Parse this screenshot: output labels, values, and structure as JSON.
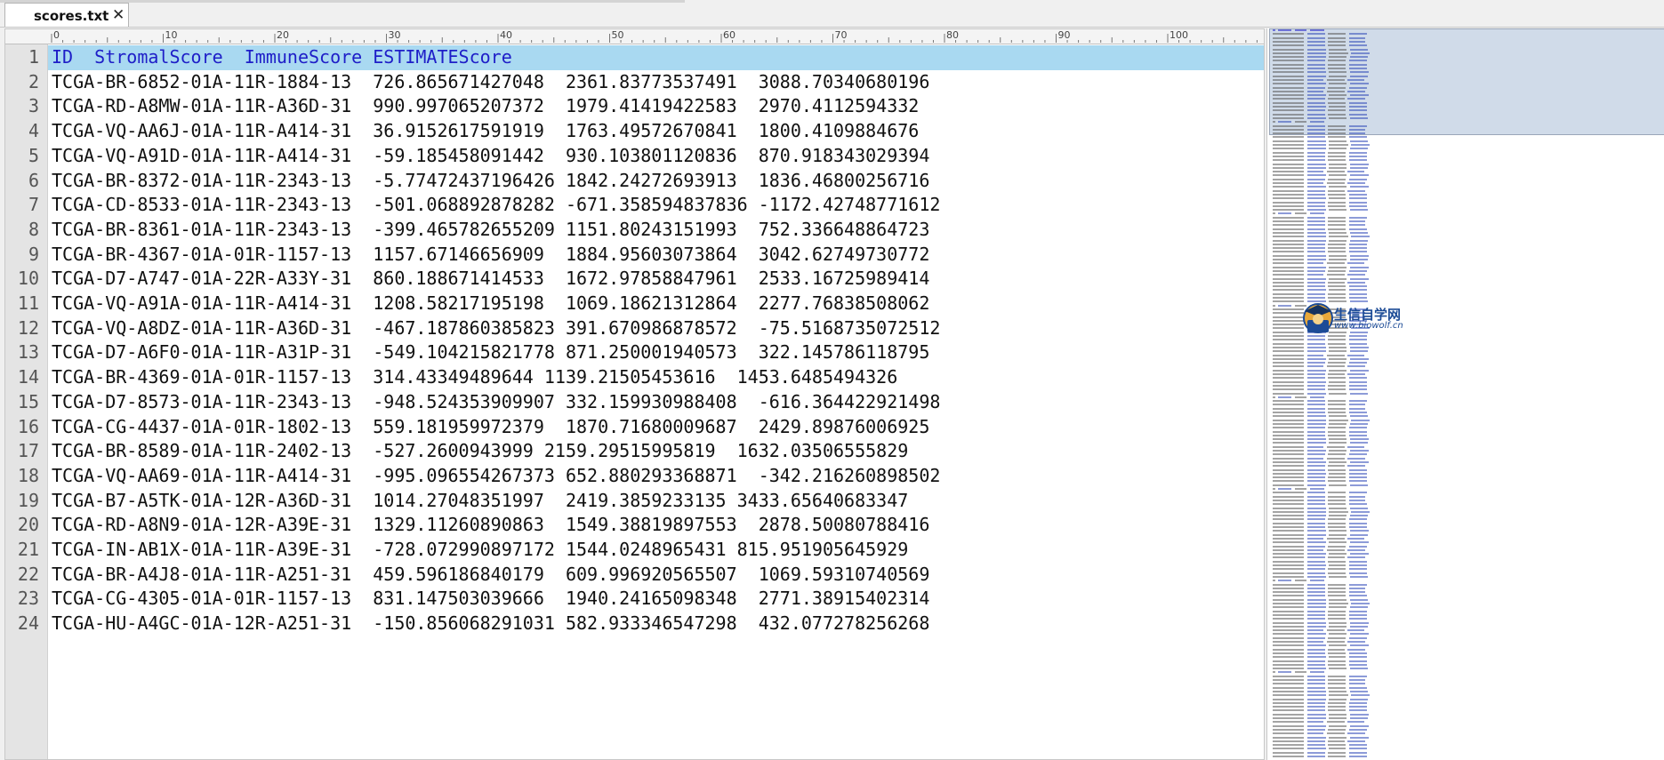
{
  "tab": {
    "title": "scores.txt",
    "close_glyph": "✕"
  },
  "ruler": {
    "labels": [
      "0",
      "10",
      "20",
      "30",
      "40",
      "50",
      "60",
      "70",
      "80",
      "90",
      "100"
    ]
  },
  "editor": {
    "current_line": 1,
    "lines": [
      {
        "num": "1",
        "text": "ID  StromalScore  ImmuneScore ESTIMATEScore"
      },
      {
        "num": "2",
        "text": "TCGA-BR-6852-01A-11R-1884-13  726.865671427048  2361.83773537491  3088.70340680196"
      },
      {
        "num": "3",
        "text": "TCGA-RD-A8MW-01A-11R-A36D-31  990.997065207372  1979.41419422583  2970.4112594332"
      },
      {
        "num": "4",
        "text": "TCGA-VQ-AA6J-01A-11R-A414-31  36.9152617591919  1763.49572670841  1800.4109884676"
      },
      {
        "num": "5",
        "text": "TCGA-VQ-A91D-01A-11R-A414-31  -59.185458091442  930.103801120836  870.918343029394"
      },
      {
        "num": "6",
        "text": "TCGA-BR-8372-01A-11R-2343-13  -5.77472437196426 1842.24272693913  1836.46800256716"
      },
      {
        "num": "7",
        "text": "TCGA-CD-8533-01A-11R-2343-13  -501.068892878282 -671.358594837836 -1172.42748771612"
      },
      {
        "num": "8",
        "text": "TCGA-BR-8361-01A-11R-2343-13  -399.465782655209 1151.80243151993  752.336648864723"
      },
      {
        "num": "9",
        "text": "TCGA-BR-4367-01A-01R-1157-13  1157.67146656909  1884.95603073864  3042.62749730772"
      },
      {
        "num": "10",
        "text": "TCGA-D7-A747-01A-22R-A33Y-31  860.188671414533  1672.97858847961  2533.16725989414"
      },
      {
        "num": "11",
        "text": "TCGA-VQ-A91A-01A-11R-A414-31  1208.58217195198  1069.18621312864  2277.76838508062"
      },
      {
        "num": "12",
        "text": "TCGA-VQ-A8DZ-01A-11R-A36D-31  -467.187860385823 391.670986878572  -75.5168735072512"
      },
      {
        "num": "13",
        "text": "TCGA-D7-A6F0-01A-11R-A31P-31  -549.104215821778 871.250001940573  322.145786118795"
      },
      {
        "num": "14",
        "text": "TCGA-BR-4369-01A-01R-1157-13  314.43349489644 1139.21505453616  1453.6485494326"
      },
      {
        "num": "15",
        "text": "TCGA-D7-8573-01A-11R-2343-13  -948.524353909907 332.159930988408  -616.364422921498"
      },
      {
        "num": "16",
        "text": "TCGA-CG-4437-01A-01R-1802-13  559.181959972379  1870.71680009687  2429.89876006925"
      },
      {
        "num": "17",
        "text": "TCGA-BR-8589-01A-11R-2402-13  -527.2600943999 2159.29515995819  1632.03506555829"
      },
      {
        "num": "18",
        "text": "TCGA-VQ-AA69-01A-11R-A414-31  -995.096554267373 652.880293368871  -342.216260898502"
      },
      {
        "num": "19",
        "text": "TCGA-B7-A5TK-01A-12R-A36D-31  1014.27048351997  2419.3859233135 3433.65640683347"
      },
      {
        "num": "20",
        "text": "TCGA-RD-A8N9-01A-12R-A39E-31  1329.11260890863  1549.38819897553  2878.50080788416"
      },
      {
        "num": "21",
        "text": "TCGA-IN-AB1X-01A-11R-A39E-31  -728.072990897172 1544.0248965431 815.951905645929"
      },
      {
        "num": "22",
        "text": "TCGA-BR-A4J8-01A-11R-A251-31  459.596186840179  609.996920565507  1069.59310740569"
      },
      {
        "num": "23",
        "text": "TCGA-CG-4305-01A-01R-1157-13  831.147503039666  1940.24165098348  2771.38915402314"
      },
      {
        "num": "24",
        "text": "TCGA-HU-A4GC-01A-12R-A251-31  -150.856068291031 582.933346547298  432.077278256268"
      }
    ]
  },
  "watermark": {
    "title": "生信自学网",
    "subtitle": "www.biowolf.cn"
  },
  "colors": {
    "current_line_bg": "#a9d9f1",
    "header_text": "#1e1ec8",
    "gutter_bg": "#e4e4e4"
  }
}
